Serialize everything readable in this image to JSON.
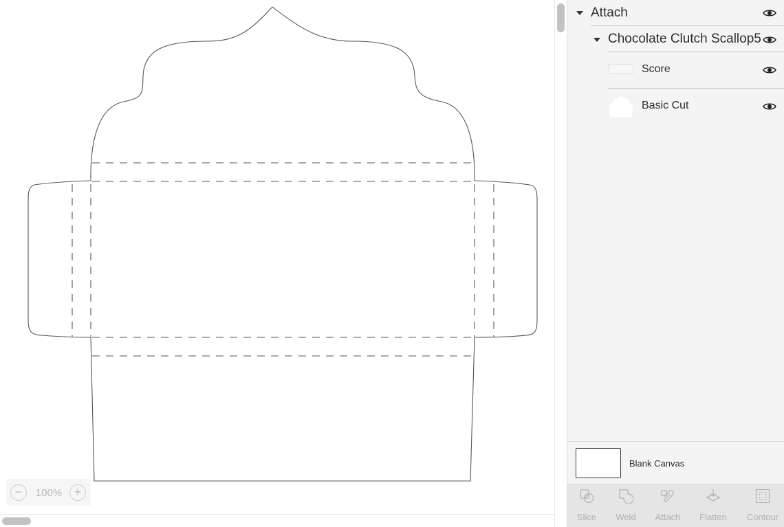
{
  "canvas": {
    "zoom_level": "100%",
    "zoom_out_glyph": "−",
    "zoom_in_glyph": "+"
  },
  "layers": {
    "group": {
      "label": "Attach",
      "expanded": true
    },
    "subgroup": {
      "label": "Chocolate Clutch Scallop5",
      "expanded": true
    },
    "items": [
      {
        "label": "Score",
        "thumbnail": "score-thumbnail"
      },
      {
        "label": "Basic Cut",
        "thumbnail": "cupcake-shape-thumbnail"
      }
    ],
    "visibility_icon": "eye-icon"
  },
  "canvas_selector": {
    "label": "Blank Canvas"
  },
  "toolbar": {
    "tools": [
      {
        "label": "Slice",
        "icon": "slice-icon"
      },
      {
        "label": "Weld",
        "icon": "weld-icon"
      },
      {
        "label": "Attach",
        "icon": "attach-icon"
      },
      {
        "label": "Flatten",
        "icon": "flatten-icon"
      },
      {
        "label": "Contour",
        "icon": "contour-icon"
      }
    ]
  },
  "colors": {
    "panel_bg": "#f4f4f4",
    "toolbar_bg": "#e5e5e5",
    "disabled_text": "#b0b0b0",
    "cut_line": "#555555",
    "score_line": "#555555"
  }
}
